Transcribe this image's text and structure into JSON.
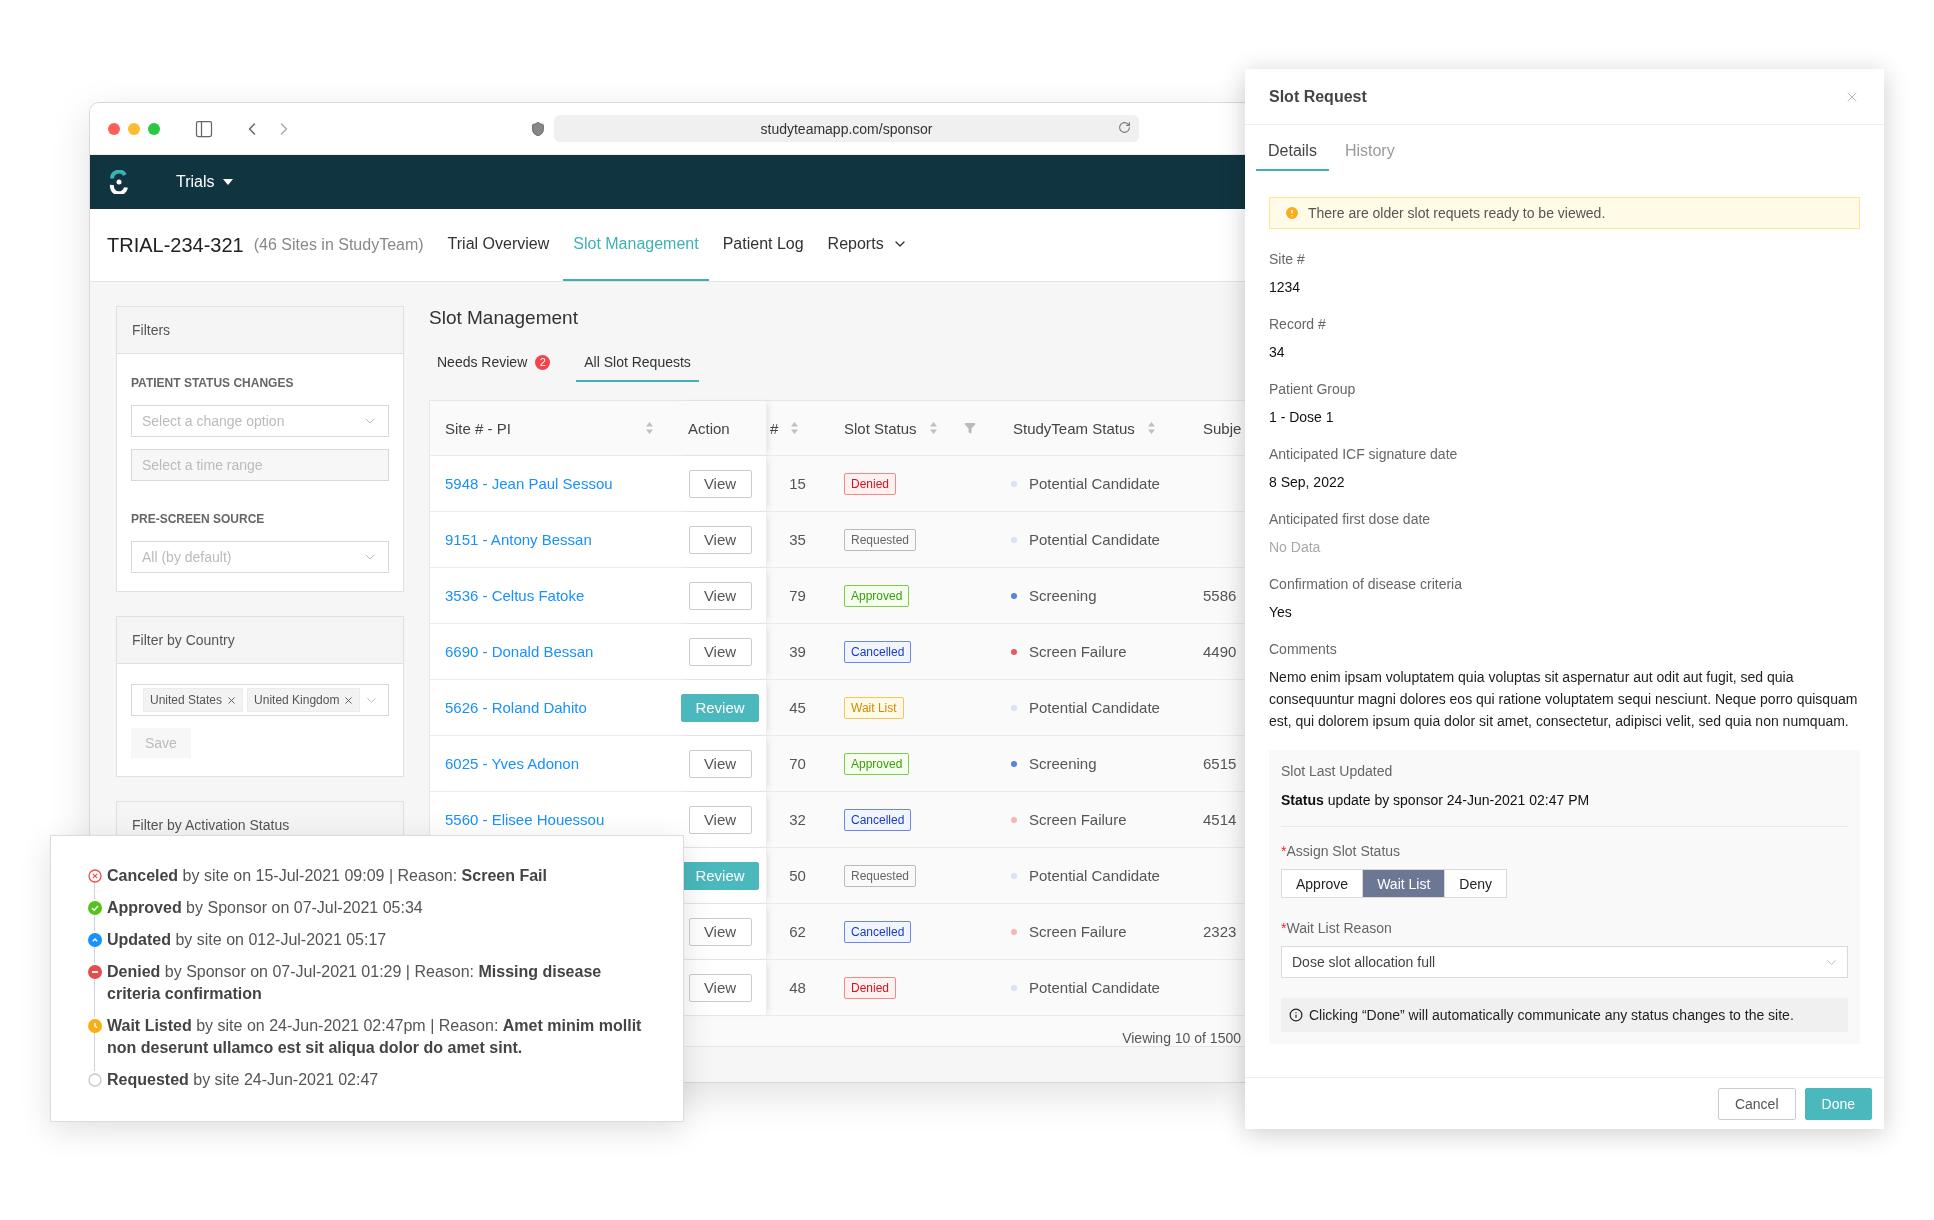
{
  "browser": {
    "url": "studyteamapp.com/sponsor"
  },
  "nav": {
    "menu": "Trials"
  },
  "trial": {
    "id": "TRIAL-234-321",
    "sites": "(46 Sites in StudyTeam)"
  },
  "page_tabs": [
    {
      "label": "Trial Overview",
      "selected": false,
      "dropdown": false
    },
    {
      "label": "Slot Management",
      "selected": true,
      "dropdown": false
    },
    {
      "label": "Patient Log",
      "selected": false,
      "dropdown": false
    },
    {
      "label": "Reports",
      "selected": false,
      "dropdown": true
    }
  ],
  "filters": {
    "title": "Filters",
    "patient_status_label": "PATIENT STATUS CHANGES",
    "change_placeholder": "Select a change option",
    "time_placeholder": "Select a time range",
    "source_label": "PRE-SCREEN SOURCE",
    "source_placeholder": "All (by default)"
  },
  "country_filter": {
    "title": "Filter by Country",
    "tags": [
      "United States",
      "United Kingdom"
    ],
    "save": {
      "label": "Save",
      "disabled": true
    }
  },
  "activation_filter": {
    "title": "Filter by Activation Status"
  },
  "main": {
    "title": "Slot Management",
    "tabs": [
      {
        "label": "Needs Review",
        "badge": "2",
        "selected": false
      },
      {
        "label": "All Slot Requests",
        "selected": true
      }
    ]
  },
  "table": {
    "columns": [
      {
        "label": "Site # - PI",
        "sortable": true,
        "filterable": false
      },
      {
        "label": "Action",
        "sortable": false,
        "filterable": false
      },
      {
        "label": "#",
        "sortable": true,
        "filterable": false
      },
      {
        "label": "Slot Status",
        "sortable": true,
        "filterable": true
      },
      {
        "label": "StudyTeam Status",
        "sortable": true,
        "filterable": false
      },
      {
        "label": "Subje",
        "sortable": false,
        "filterable": false
      }
    ],
    "rows": [
      {
        "site": "5948 - Jean Paul Sessou",
        "action": {
          "kind": "view",
          "label": "View"
        },
        "number": "15",
        "slot_status": {
          "kind": "denied",
          "label": "Denied"
        },
        "study_status": {
          "label": "Potential Candidate",
          "color": "#d9e1f5"
        }
      },
      {
        "site": "9151 - Antony Bessan",
        "action": {
          "kind": "view",
          "label": "View"
        },
        "number": "35",
        "slot_status": {
          "kind": "requested",
          "label": "Requested"
        },
        "study_status": {
          "label": "Potential Candidate",
          "color": "#d9e1f5"
        }
      },
      {
        "site": "3536 - Celtus Fatoke",
        "action": {
          "kind": "view",
          "label": "View"
        },
        "number": "79",
        "slot_status": {
          "kind": "approved",
          "label": "Approved"
        },
        "study_status": {
          "label": "Screening",
          "color": "#5b80e6"
        },
        "subject": "5586"
      },
      {
        "site": "6690 - Donald Bessan",
        "action": {
          "kind": "view",
          "label": "View"
        },
        "number": "39",
        "slot_status": {
          "kind": "cancelled",
          "label": "Cancelled"
        },
        "study_status": {
          "label": "Screen Failure",
          "color": "#e65a5a"
        },
        "subject": "4490"
      },
      {
        "site": "5626 - Roland Dahito",
        "action": {
          "kind": "review",
          "label": "Review"
        },
        "number": "45",
        "slot_status": {
          "kind": "waitlist",
          "label": "Wait List"
        },
        "study_status": {
          "label": "Potential Candidate",
          "color": "#d9e1f5"
        }
      },
      {
        "site": "6025 - Yves Adonon",
        "action": {
          "kind": "view",
          "label": "View"
        },
        "number": "70",
        "slot_status": {
          "kind": "approved",
          "label": "Approved"
        },
        "study_status": {
          "label": "Screening",
          "color": "#5b80e6"
        },
        "subject": "6515"
      },
      {
        "site": "5560 - Elisee Houessou",
        "action": {
          "kind": "view",
          "label": "View"
        },
        "number": "32",
        "slot_status": {
          "kind": "cancelled",
          "label": "Cancelled"
        },
        "study_status": {
          "label": "Screen Failure",
          "color": "#f2b8b8"
        },
        "subject": "4514"
      },
      {
        "action": {
          "kind": "review",
          "label": "Review"
        },
        "number": "50",
        "slot_status": {
          "kind": "requested",
          "label": "Requested"
        },
        "study_status": {
          "label": "Potential Candidate",
          "color": "#d9e1f5"
        }
      },
      {
        "action": {
          "kind": "view",
          "label": "View"
        },
        "number": "62",
        "slot_status": {
          "kind": "cancelled",
          "label": "Cancelled"
        },
        "study_status": {
          "label": "Screen Failure",
          "color": "#f2b8b8"
        },
        "subject": "2323"
      },
      {
        "action": {
          "kind": "view",
          "label": "View"
        },
        "number": "48",
        "slot_status": {
          "kind": "denied",
          "label": "Denied"
        },
        "study_status": {
          "label": "Potential Candidate",
          "color": "#d9e1f5"
        }
      }
    ],
    "footer": "Viewing 10 of 1500"
  },
  "history_popup": {
    "events": [
      {
        "kind": "canceled",
        "text": "**Canceled** by site on 15-Jul-2021 09:09 | Reason: **Screen Fail**"
      },
      {
        "kind": "approved",
        "text": "**Approved** by Sponsor on 07-Jul-2021 05:34"
      },
      {
        "kind": "updated",
        "text": "**Updated** by site on 012-Jul-2021 05:17"
      },
      {
        "kind": "denied",
        "text": "**Denied** by Sponsor on 07-Jul-2021 01:29 | Reason: **Missing disease criteria confirmation**"
      },
      {
        "kind": "waitlisted",
        "text": "**Wait Listed** by site on 24-Jun-2021 02:47pm | Reason: **Amet minim mollit non deserunt ullamco est sit aliqua dolor do amet sint.**"
      },
      {
        "kind": "requested",
        "text": "**Requested** by site 24-Jun-2021 02:47"
      }
    ]
  },
  "slot_request": {
    "title": "Slot Request",
    "tabs": [
      {
        "label": "Details",
        "selected": true
      },
      {
        "label": "History",
        "selected": false
      }
    ],
    "alert": "There are older slot requets ready to be viewed.",
    "fields": [
      {
        "label": "Site #",
        "value": "1234",
        "empty": false
      },
      {
        "label": "Record #",
        "value": "34",
        "empty": false
      },
      {
        "label": "Patient Group",
        "value": "1 - Dose 1",
        "empty": false
      },
      {
        "label": "Anticipated ICF signature date",
        "value": "8 Sep, 2022",
        "empty": false
      },
      {
        "label": "Anticipated first dose date",
        "value": "No Data",
        "empty": true
      },
      {
        "label": "Confirmation of disease criteria",
        "value": "Yes",
        "empty": false
      }
    ],
    "comments_label": "Comments",
    "comments": "Nemo enim ipsam voluptatem quia voluptas sit aspernatur aut odit aut fugit, sed quia consequuntur magni dolores eos qui ratione voluptatem sequi nesciunt. Neque porro quisquam est, qui dolorem ipsum quia dolor sit amet, consectetur, adipisci velit, sed quia non numquam.",
    "last_updated": {
      "label": "Slot Last Updated",
      "text": "**Status** update by sponsor 24-Jun-2021 02:47 PM"
    },
    "assign": {
      "label": "Assign Slot Status",
      "required_mark": "*",
      "options": [
        {
          "label": "Approve",
          "selected": false
        },
        {
          "label": "Wait List",
          "selected": true
        },
        {
          "label": "Deny",
          "selected": false
        }
      ]
    },
    "reason": {
      "label": "Wait List Reason",
      "required_mark": "*",
      "value": "Dose slot allocation full"
    },
    "note": "Clicking “Done” will automatically communicate any status changes to the site.",
    "buttons": [
      {
        "label": "Cancel",
        "kind": "secondary"
      },
      {
        "label": "Done",
        "kind": "primary"
      }
    ]
  }
}
